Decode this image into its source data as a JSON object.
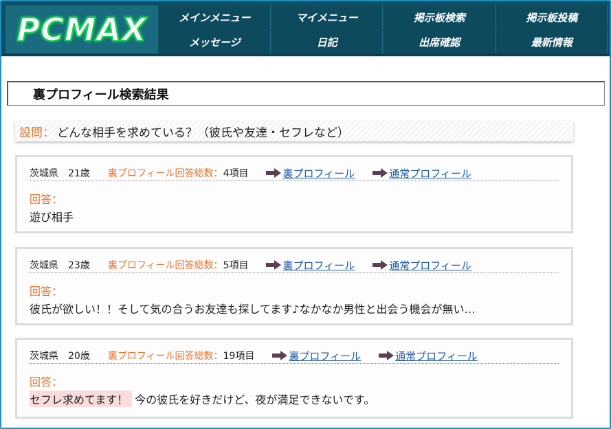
{
  "header": {
    "logo_text": "PCMAX",
    "nav": [
      {
        "label": "メインメニュー"
      },
      {
        "label": "マイメニュー"
      },
      {
        "label": "掲示板検索"
      },
      {
        "label": "掲示板投稿"
      },
      {
        "label": "メッセージ"
      },
      {
        "label": "日記"
      },
      {
        "label": "出席確認"
      },
      {
        "label": "最新情報"
      }
    ]
  },
  "page": {
    "title": "裏プロフィール検索結果"
  },
  "question": {
    "label": "設問：",
    "text": "どんな相手を求めている？（彼氏や友達・セフレなど）"
  },
  "results": [
    {
      "prefecture": "茨城県",
      "age": "21歳",
      "count_label": "裏プロフィール回答総数：",
      "count": "4項目",
      "link_ura": "裏プロフィール",
      "link_normal": "通常プロフィール",
      "answer_label": "回答：",
      "answer_highlight": "",
      "answer_text": "遊び相手"
    },
    {
      "prefecture": "茨城県",
      "age": "23歳",
      "count_label": "裏プロフィール回答総数：",
      "count": "5項目",
      "link_ura": "裏プロフィール",
      "link_normal": "通常プロフィール",
      "answer_label": "回答：",
      "answer_highlight": "",
      "answer_text": "彼氏が欲しい！！そして気の合うお友達も探してます♪なかなか男性と出会う機会が無い…"
    },
    {
      "prefecture": "茨城県",
      "age": "20歳",
      "count_label": "裏プロフィール回答総数：",
      "count": "19項目",
      "link_ura": "裏プロフィール",
      "link_normal": "通常プロフィール",
      "answer_label": "回答：",
      "answer_highlight": "セフレ求めてます！",
      "answer_text": "今の彼氏を好きだけど、夜が満足できないです。"
    }
  ],
  "colors": {
    "header_bg": "#0f4f63",
    "accent_orange": "#e8722a",
    "link_blue": "#1e5aa8",
    "logo_green": "#19d25a",
    "highlight_pink": "#fbdcdc"
  }
}
